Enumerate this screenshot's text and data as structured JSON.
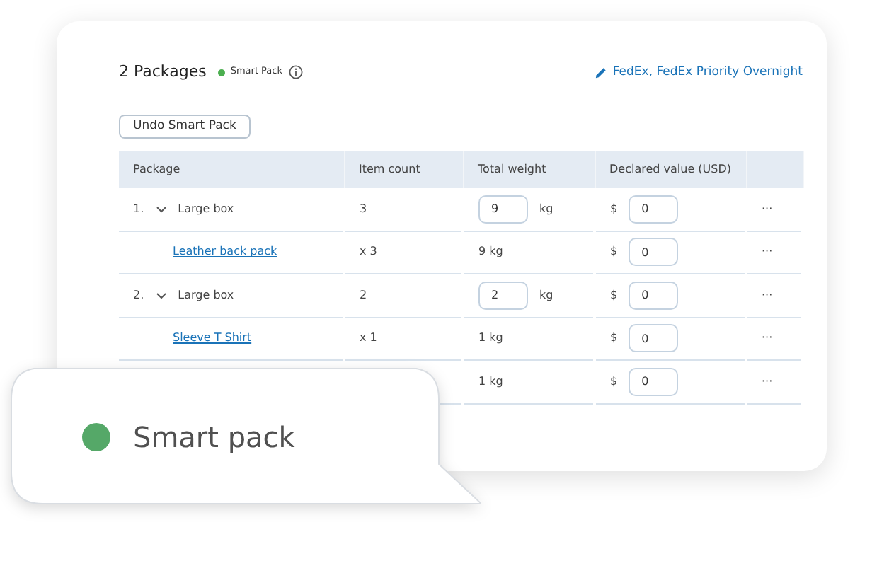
{
  "header": {
    "title": "2 Packages",
    "badge": "Smart Pack",
    "carrier_link": "FedEx, FedEx Priority Overnight"
  },
  "undo_button": "Undo Smart Pack",
  "table": {
    "columns": [
      "Package",
      "Item count",
      "Total weight",
      "Declared value (USD)"
    ],
    "rows": [
      {
        "kind": "package",
        "number": "1.",
        "expanded": true,
        "name": "Large box",
        "count": "3",
        "weight": "9",
        "unit": "kg",
        "currency": "$",
        "value": "0",
        "menu": "···"
      },
      {
        "kind": "item",
        "name": "Leather back pack",
        "count": "x 3",
        "weight": "9 kg",
        "currency": "$",
        "value": "0",
        "menu": "···"
      },
      {
        "kind": "package",
        "number": "2.",
        "expanded": true,
        "name": "Large box",
        "count": "2",
        "weight": "2",
        "unit": "kg",
        "currency": "$",
        "value": "0",
        "menu": "···"
      },
      {
        "kind": "item",
        "name": "Sleeve T Shirt",
        "count": "x 1",
        "weight": "1 kg",
        "currency": "$",
        "value": "0",
        "menu": "···"
      },
      {
        "kind": "item",
        "weight": "1 kg",
        "currency": "$",
        "value": "0",
        "menu": "···"
      }
    ]
  },
  "callout": {
    "label": "Smart pack"
  }
}
